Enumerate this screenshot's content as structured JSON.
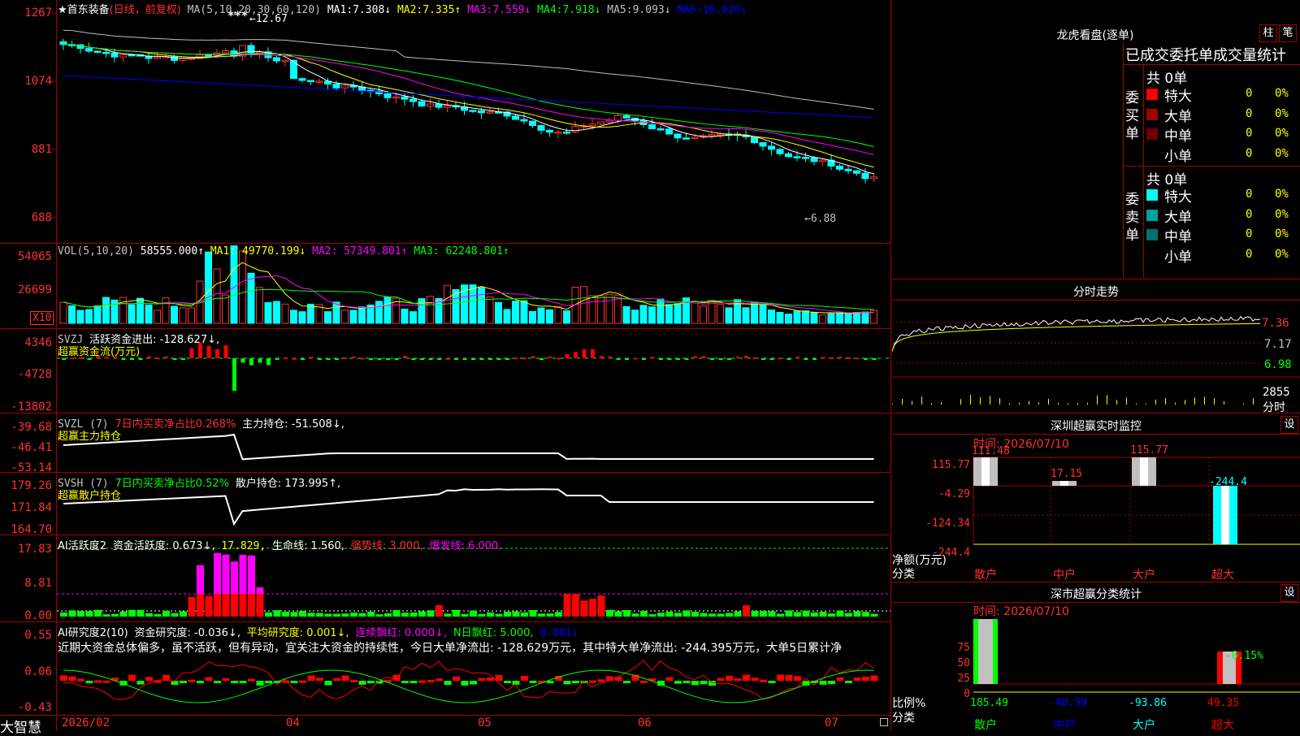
{
  "stock": {
    "name": "★首东装备",
    "mode": "(日线，前复权)"
  },
  "main": {
    "ma_label": "MA(5,10,20,30,60,120)",
    "ma": [
      {
        "name": "MA1:",
        "value": "7.308↓",
        "color": "#ffffff"
      },
      {
        "name": "MA2:",
        "value": "7.335↑",
        "color": "#ffff00"
      },
      {
        "name": "MA3:",
        "value": "7.559↓",
        "color": "#ff00ff"
      },
      {
        "name": "MA4:",
        "value": "7.918↓",
        "color": "#00ff00"
      },
      {
        "name": "MA5:",
        "value": "9.093↓",
        "color": "#c0c0c0"
      },
      {
        "name": "MA6:",
        "value": "10.020↓",
        "color": "#0000ff"
      }
    ],
    "yticks": [
      "1267",
      "1074",
      "881",
      "688"
    ],
    "high_label": "←12.67",
    "low_label": "←6.88",
    "stars": "***"
  },
  "vol": {
    "label": "VOL(5,10,20)",
    "value": "58555.000↑",
    "ma": [
      {
        "t": "MA1: 49770.199↓",
        "c": "#ffff00"
      },
      {
        "t": "MA2: 57349.801↑",
        "c": "#ff00ff"
      },
      {
        "t": "MA3: 62248.801↑",
        "c": "#00ff00"
      }
    ],
    "yticks": [
      "54065",
      "26699"
    ],
    "unit": "X10"
  },
  "svzj": {
    "label": "SVZJ",
    "t1": "活跃资金进出: -128.627↓,",
    "t2": "超赢资金流(万元)",
    "yticks": [
      "4346",
      "-4728",
      "-13802"
    ]
  },
  "svzl": {
    "label": "SVZL (7)",
    "t1": "7日内买卖净占比0.268%",
    "t2": "主力持仓: -51.508↓,",
    "t3": "超赢主力持仓",
    "yticks": [
      "-39.68",
      "-46.41",
      "-53.14"
    ]
  },
  "svsh": {
    "label": "SVSH (7)",
    "t1": "7日内买卖净占比0.52%",
    "t2": "散户持仓: 173.995↑,",
    "t3": "超赢散户持仓",
    "yticks": [
      "179.26",
      "171.84",
      "164.70"
    ]
  },
  "ai1": {
    "label": "AI活跃度2",
    "t1": "资金活跃度: 0.673↓,",
    "t2": "17.829,",
    "t3": "生命线: 1.560,",
    "t4": "强势线: 3.000,",
    "t5": "爆发线: 6.000,",
    "yticks": [
      "17.83",
      "8.81",
      "0.00"
    ]
  },
  "ai2": {
    "label": "AI研究度2(10)",
    "t1": "资金研究度: -0.036↓,",
    "t2": "平均研究度: 0.001↓,",
    "t3": "连续飘红: 0.000↓,",
    "t4": "N日飘红: 5.000,",
    "t5": "0.001↓",
    "desc": "近期大资金总体偏多，虽不活跃，但有异动，宜关注大资金的持续性，今日大单净流出: -128.629万元，其中特大单净流出: -244.395万元，大单5日累计净",
    "yticks": [
      "0.55",
      "0.06",
      "-0.43"
    ]
  },
  "xaxis": {
    "brand": "大智慧",
    "labels": [
      "2026/02",
      "04",
      "05",
      "06",
      "07"
    ]
  },
  "lhb": {
    "title": "龙虎看盘(逐单)",
    "btn1": "柱",
    "btn2": "笔",
    "subtitle": "已成交委托单成交量统计",
    "buy": {
      "side": "委买单",
      "total": "共 0单",
      "rows": [
        {
          "label": "特大",
          "v": "0",
          "p": "0%",
          "c": "#ff0000"
        },
        {
          "label": "大单",
          "v": "0",
          "p": "0%",
          "c": "#a00000"
        },
        {
          "label": "中单",
          "v": "0",
          "p": "0%",
          "c": "#700000"
        },
        {
          "label": "小单",
          "v": "0",
          "p": "0%",
          "c": ""
        }
      ]
    },
    "sell": {
      "side": "委卖单",
      "total": "共 0单",
      "rows": [
        {
          "label": "特大",
          "v": "0",
          "p": "0%",
          "c": "#00ffff"
        },
        {
          "label": "大单",
          "v": "0",
          "p": "0%",
          "c": "#00a0a0"
        },
        {
          "label": "中单",
          "v": "0",
          "p": "0%",
          "c": "#007070"
        },
        {
          "label": "小单",
          "v": "0",
          "p": "0%",
          "c": ""
        }
      ]
    }
  },
  "intraday": {
    "title": "分时走势",
    "yticks": [
      "7.36",
      "7.17",
      "6.98"
    ],
    "vol": "2855",
    "vol_unit": "分时"
  },
  "monitor": {
    "title": "深圳超赢实时监控",
    "btn": "设",
    "time": "时间: 2026/07/10",
    "yticks": [
      "115.77",
      "-4.29",
      "-124.34",
      "-244.4"
    ],
    "ylabel": "净额(万元)",
    "xlabel": "分类",
    "bars": [
      {
        "cat": "散户",
        "v": "111.48"
      },
      {
        "cat": "中户",
        "v": "17.15"
      },
      {
        "cat": "大户",
        "v": "115.77"
      },
      {
        "cat": "超大",
        "v": "-244.4"
      }
    ]
  },
  "stats": {
    "title": "深市超赢分类统计",
    "btn": "设",
    "time": "时间: 2026/07/10",
    "yticks": [
      "75",
      "50",
      "25",
      "0"
    ],
    "ylabel": "比例%",
    "xlabel": "分类",
    "cats": [
      {
        "cat": "散户",
        "v": "185.49",
        "c": "#00ff00"
      },
      {
        "cat": "中户",
        "v": "-40.99",
        "c": "#0000ff"
      },
      {
        "cat": "大户",
        "v": "-93.86",
        "c": "#00ffff"
      },
      {
        "cat": "超大",
        "v": "49.35",
        "c": "#ff0000"
      }
    ],
    "top_label": "-0.15%"
  }
}
